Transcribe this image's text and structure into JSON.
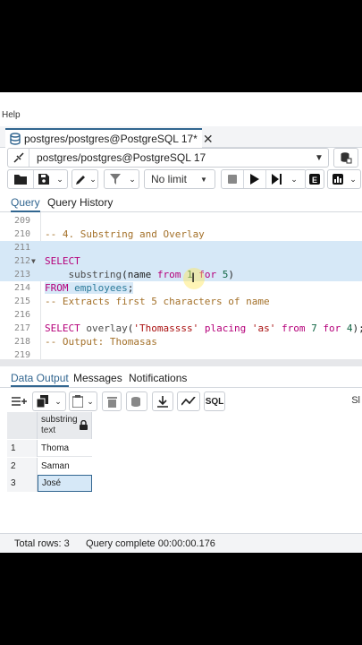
{
  "menu": {
    "help_label": "Help"
  },
  "tab": {
    "label": "postgres/postgres@PostgreSQL 17*",
    "close": "✕"
  },
  "connection": {
    "value": "postgres/postgres@PostgreSQL 17"
  },
  "toolbar": {
    "limit_value": "No limit"
  },
  "query_tabs": {
    "query": "Query",
    "history": "Query History"
  },
  "editor": {
    "lines": [
      {
        "num": "209",
        "code": ""
      },
      {
        "num": "210",
        "code": "-- 4. Substring and Overlay"
      },
      {
        "num": "211",
        "code": ""
      },
      {
        "num": "212",
        "code": "SELECT"
      },
      {
        "num": "213",
        "code": "    substring(name from 1 for 5)"
      },
      {
        "num": "214",
        "code": "FROM employees;"
      },
      {
        "num": "215",
        "code": "-- Extracts first 5 characters of name"
      },
      {
        "num": "216",
        "code": ""
      },
      {
        "num": "217",
        "code": "SELECT overlay('Thomassss' placing 'as' from 7 for 4);"
      },
      {
        "num": "218",
        "code": "-- Output: Thomasas"
      },
      {
        "num": "219",
        "code": ""
      }
    ]
  },
  "output_tabs": {
    "data_output": "Data Output",
    "messages": "Messages",
    "notifications": "Notifications"
  },
  "output_toolbar": {
    "sql_label": "SQL",
    "trailing": "Sl"
  },
  "grid": {
    "column": {
      "name": "substring",
      "type": "text"
    },
    "rows": [
      {
        "n": "1",
        "value": "Thoma"
      },
      {
        "n": "2",
        "value": "Saman"
      },
      {
        "n": "3",
        "value": "José"
      }
    ]
  },
  "status": {
    "rows": "Total rows: 3",
    "query": "Query complete 00:00:00.176"
  },
  "colors": {
    "accent": "#326690",
    "selection": "#d6e8f7"
  }
}
